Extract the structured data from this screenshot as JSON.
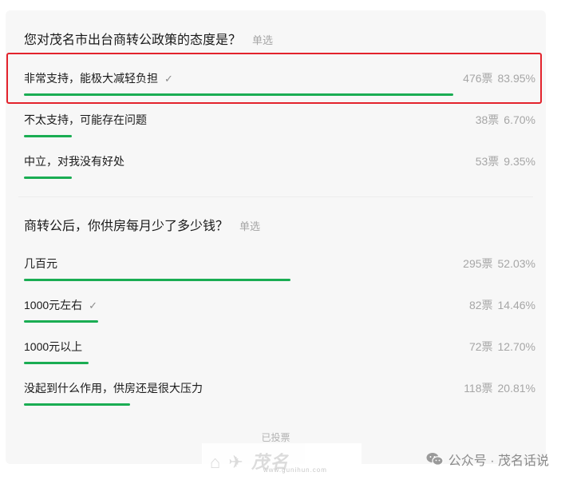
{
  "questions": [
    {
      "title": "您对茂名市出台商转公政策的态度是？",
      "type": "单选",
      "options": [
        {
          "label": "非常支持，能极大减轻负担",
          "votes": "476票",
          "percent": "83.95%",
          "fraction": 0.8395,
          "checked": true
        },
        {
          "label": "不太支持，可能存在问题",
          "votes": "38票",
          "percent": "6.70%",
          "fraction": 0.067,
          "checked": false
        },
        {
          "label": "中立，对我没有好处",
          "votes": "53票",
          "percent": "9.35%",
          "fraction": 0.0935,
          "checked": false
        }
      ]
    },
    {
      "title": "商转公后，你供房每月少了多少钱？",
      "type": "单选",
      "options": [
        {
          "label": "几百元",
          "votes": "295票",
          "percent": "52.03%",
          "fraction": 0.5203,
          "checked": false
        },
        {
          "label": "1000元左右",
          "votes": "82票",
          "percent": "14.46%",
          "fraction": 0.1446,
          "checked": true
        },
        {
          "label": "1000元以上",
          "votes": "72票",
          "percent": "12.70%",
          "fraction": 0.127,
          "checked": false
        },
        {
          "label": "没起到什么作用，供房还是很大压力",
          "votes": "118票",
          "percent": "20.81%",
          "fraction": 0.2081,
          "checked": false
        }
      ]
    }
  ],
  "status": "已投票",
  "footer": {
    "account": "公众号 · 茂名话说",
    "icon": "wechat-icon"
  },
  "watermark": {
    "text": "www.gunihun.com"
  },
  "colors": {
    "bar": "#1aad53",
    "highlight": "#e3232c",
    "card": "#f7f7f7"
  }
}
